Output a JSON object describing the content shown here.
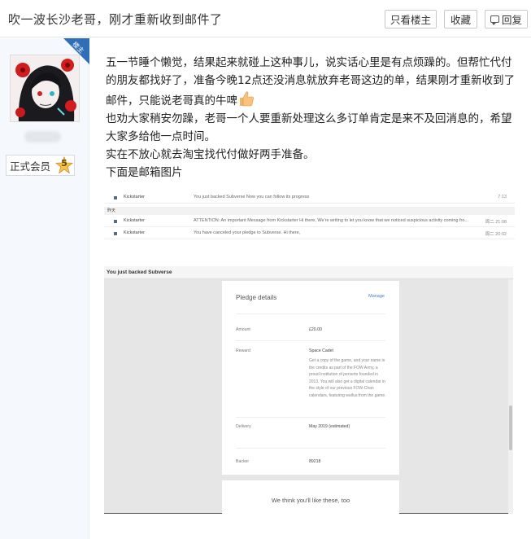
{
  "header": {
    "title": "吹一波长沙老哥，刚才重新收到邮件了",
    "only_op_label": "只看楼主",
    "favorite_label": "收藏",
    "reply_label": "回复"
  },
  "author": {
    "op_badge": "楼主",
    "rank_label": "正式会员",
    "rank_level": "5"
  },
  "post": {
    "paragraphs": [
      "五一节睡个懒觉，结果起来就碰上这种事儿，说实话心里是有点烦躁的。但帮忙代付的朋友都找好了，准备今晚12点还没消息就放弃老哥这边的单，结果刚才重新收到了邮件，只能说老哥真的牛啤",
      "也劝大家稍安勿躁，老哥一个人要重新处理这么多订单肯定是来不及回消息的，希望大家多给他一点时间。",
      "实在不放心就去淘宝找代付做好两手准备。",
      "下面是邮箱图片"
    ]
  },
  "inbox": {
    "rows_top": [
      {
        "sender": "Kickstarter",
        "subject": "You just backed Subverse   Now you can follow its progress",
        "date": "7:13"
      }
    ],
    "day_label": "昨天",
    "rows_bottom": [
      {
        "sender": "Kickstarter",
        "subject": "ATTENTION: An important Message from Kickstarter   Hi there, We're writing to let you know that we noticed suspicious activity coming fro...",
        "date": "周二 21:08"
      },
      {
        "sender": "Kickstarter",
        "subject": "You have canceled your pledge to Subverse.   Hi there,",
        "date": "周二 20:02"
      }
    ]
  },
  "email": {
    "subject": "You just backed Subverse",
    "card_title": "Pledge details",
    "manage_label": "Manage",
    "amount_key": "Amount",
    "amount_val": "£20.00",
    "reward_key": "Reward",
    "reward_val": "Space Cadet",
    "reward_desc": "Get a copy of the game, and your name in the credits as part of the FOW Army, a proud institution of perverts founded in 2013. You will also get a digital calendar in the style of our previous FOW-Chan calendars, featuring waifus from the game.",
    "delivery_key": "Delivery",
    "delivery_val": "May 2019 (estimated)",
    "backer_key": "Backer",
    "backer_val": "89218",
    "suggest_text": "We think you'll like these, too"
  },
  "colors": {
    "accent_blue": "#2f6fb8",
    "left_bg": "#f5f8fc"
  }
}
